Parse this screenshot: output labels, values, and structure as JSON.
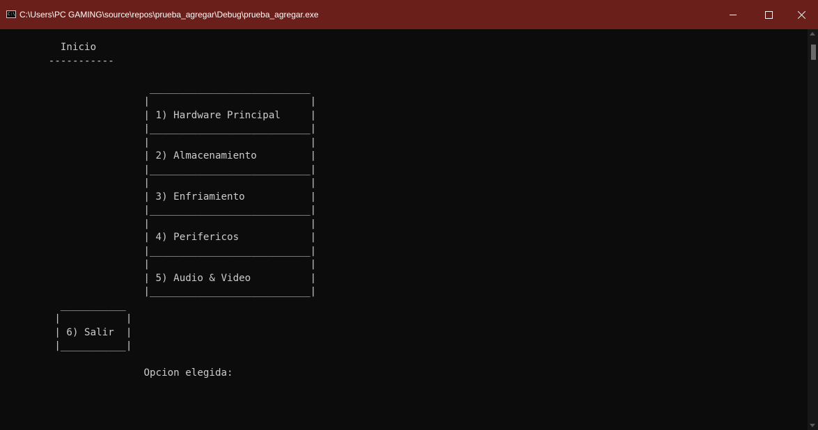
{
  "window": {
    "title": "C:\\Users\\PC GAMING\\source\\repos\\prueba_agregar\\Debug\\prueba_agregar.exe",
    "icon_text": "C:\\"
  },
  "console": {
    "lines": [
      "         Inicio",
      "       -----------",
      "",
      "                        ___________________________",
      "                       |                           |",
      "                       | 1) Hardware Principal     |",
      "                       |___________________________|",
      "                       |                           |",
      "                       | 2) Almacenamiento         |",
      "                       |___________________________|",
      "                       |                           |",
      "                       | 3) Enfriamiento           |",
      "                       |___________________________|",
      "                       |                           |",
      "                       | 4) Perifericos            |",
      "                       |___________________________|",
      "                       |                           |",
      "                       | 5) Audio & Video          |",
      "                       |___________________________|",
      "         ___________",
      "        |           |",
      "        | 6) Salir  |",
      "        |___________|",
      "",
      "                       Opcion elegida:"
    ]
  },
  "colors": {
    "titlebar_bg": "#6b1f1a",
    "console_bg": "#0c0c0c",
    "console_text": "#cccccc"
  }
}
